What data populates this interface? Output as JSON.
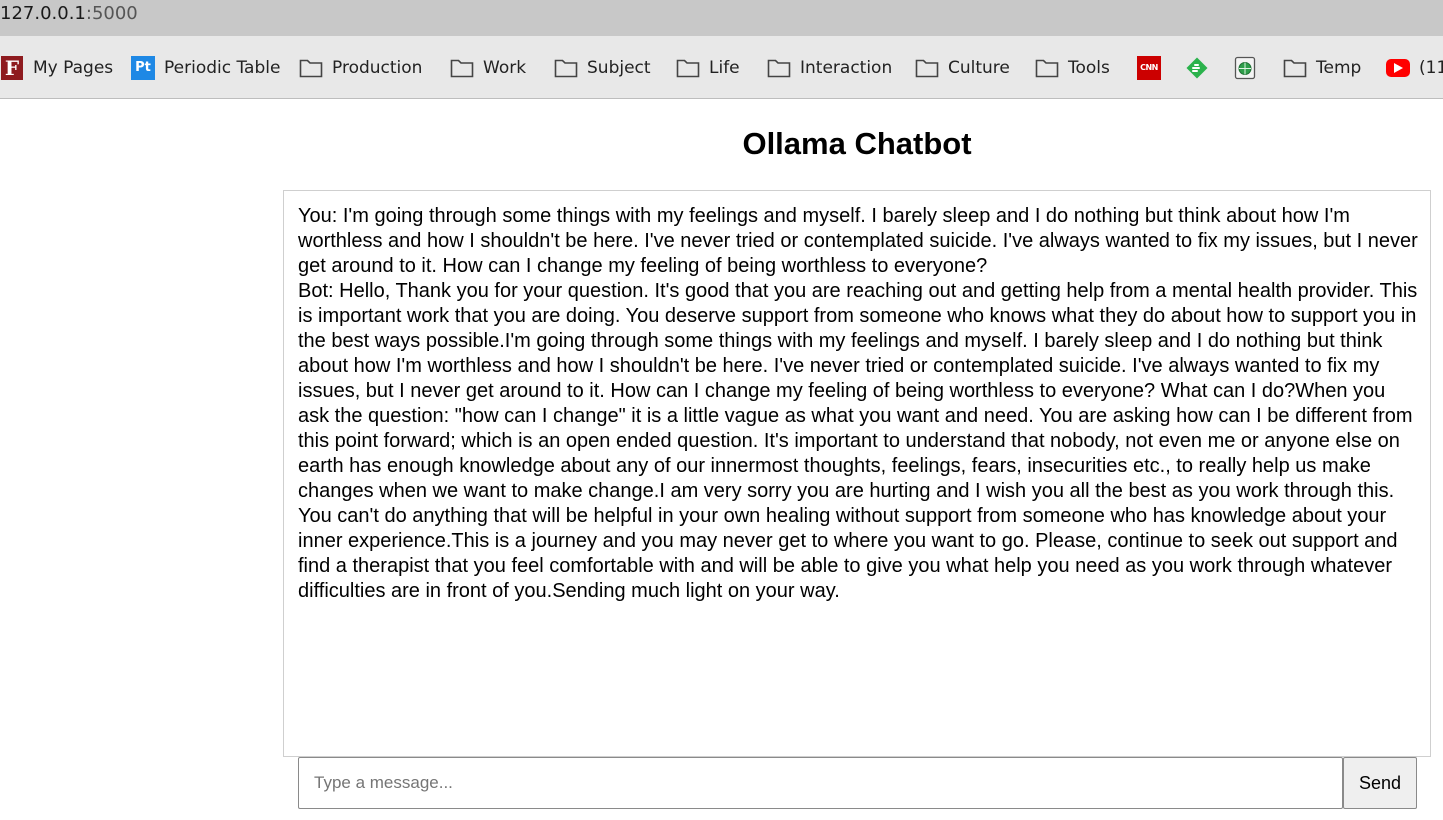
{
  "browser": {
    "url_host": "127.0.0.1",
    "url_port": ":5000"
  },
  "bookmarks": [
    {
      "label": "My Pages",
      "icon": "f-favicon-icon"
    },
    {
      "label": "Periodic Table",
      "icon": "pt-favicon-icon"
    },
    {
      "label": "Production",
      "icon": "folder-icon"
    },
    {
      "label": "Work",
      "icon": "folder-icon"
    },
    {
      "label": "Subject",
      "icon": "folder-icon"
    },
    {
      "label": "Life",
      "icon": "folder-icon"
    },
    {
      "label": "Interaction",
      "icon": "folder-icon"
    },
    {
      "label": "Culture",
      "icon": "folder-icon"
    },
    {
      "label": "Tools",
      "icon": "folder-icon"
    },
    {
      "label": "",
      "icon": "cnn-favicon-icon"
    },
    {
      "label": "",
      "icon": "feedly-favicon-icon"
    },
    {
      "label": "",
      "icon": "globe-favicon-icon"
    },
    {
      "label": "Temp",
      "icon": "folder-icon"
    },
    {
      "label": "(11",
      "icon": "youtube-favicon-icon"
    }
  ],
  "icon_text": {
    "f": "F",
    "pt": "Pt",
    "cnn": "CNN"
  },
  "colors": {
    "address_bar": "#c8c8c8",
    "bookmarks_bar": "#e8e8e8",
    "youtube_red": "#ff0000",
    "cnn_red": "#cc0000",
    "feedly_green": "#2bb24c"
  },
  "page": {
    "title": "Ollama Chatbot"
  },
  "chat": {
    "messages": [
      "You: I'm going through some things with my feelings and myself. I barely sleep and I do nothing but think about how I'm worthless and how I shouldn't be here. I've never tried or contemplated suicide. I've always wanted to fix my issues, but I never get around to it. How can I change my feeling of being worthless to everyone?",
      "Bot: Hello, Thank you for your question. It's good that you are reaching out and getting help from a mental health provider. This is important work that you are doing. You deserve support from someone who knows what they do about how to support you in the best ways possible.I'm going through some things with my feelings and myself. I barely sleep and I do nothing but think about how I'm worthless and how I shouldn't be here. I've never tried or contemplated suicide. I've always wanted to fix my issues, but I never get around to it. How can I change my feeling of being worthless to everyone? What can I do?When you ask the question: \"how can I change\" it is a little vague as what you want and need. You are asking how can I be different from this point forward; which is an open ended question. It's important to understand that nobody, not even me or anyone else on earth has enough knowledge about any of our innermost thoughts, feelings, fears, insecurities etc., to really help us make changes when we want to make change.I am very sorry you are hurting and I wish you all the best as you work through this. You can't do anything that will be helpful in your own healing without support from someone who has knowledge about your inner experience.This is a journey and you may never get to where you want to go. Please, continue to seek out support and find a therapist that you feel comfortable with and will be able to give you what help you need as you work through whatever difficulties are in front of you.Sending much light on your way."
    ]
  },
  "composer": {
    "value": "",
    "placeholder": "Type a message...",
    "send_label": "Send"
  }
}
